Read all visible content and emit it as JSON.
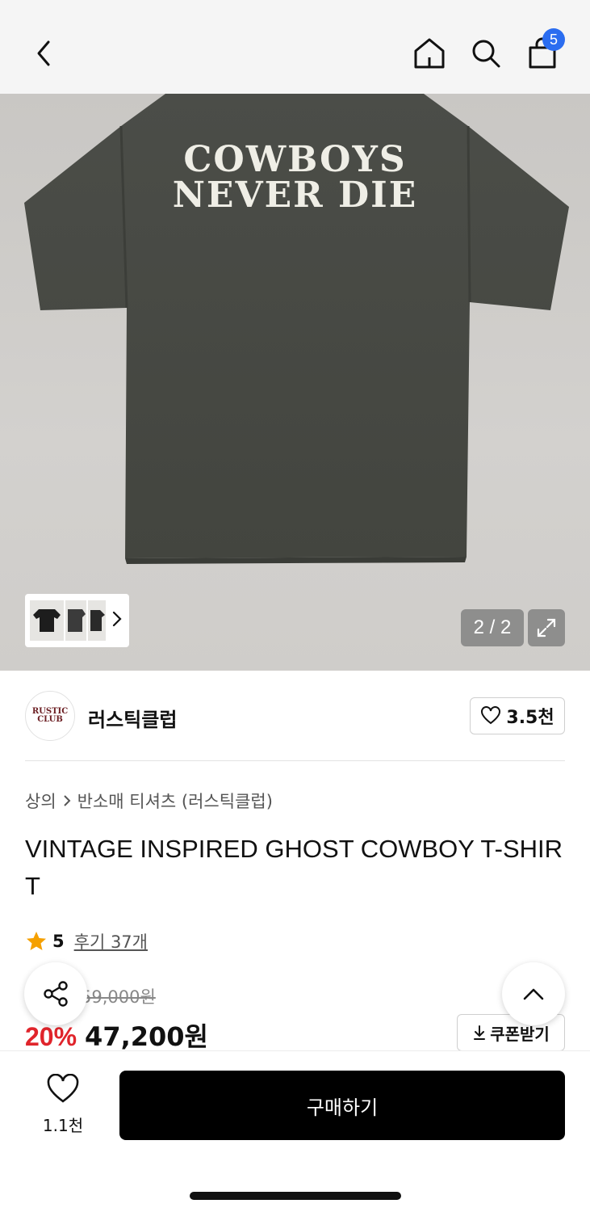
{
  "header": {
    "back_icon": "chevron-left-icon",
    "home_icon": "home-icon",
    "search_icon": "search-icon",
    "cart_icon": "shopping-bag-icon",
    "cart_count": "5",
    "badge_color": "#2b6df0"
  },
  "gallery": {
    "print_line1": "COWBOYS",
    "print_line2": "NEVER DIE",
    "pager": "2 / 2",
    "expand_icon": "expand-icon",
    "thumb_next_icon": "chevron-right-icon"
  },
  "brand": {
    "logo_line1": "RUSTIC",
    "logo_line2": "CLUB",
    "name": "러스틱클럽",
    "likes": "3.5천",
    "logo_color": "#6b1d22"
  },
  "breadcrumb": {
    "items": [
      "상의",
      "반소매 티셔츠 (러스틱클럽)"
    ]
  },
  "product": {
    "title": "VINTAGE INSPIRED GHOST COWBOY T-SHIRT",
    "rating": "5",
    "reviews": "후기 37개",
    "original_price": "59,000원",
    "discount": "20%",
    "price": "47,200원",
    "discount_color": "#e0242b"
  },
  "coupon": {
    "label": "쿠폰받기"
  },
  "bottom": {
    "wish_count": "1.1천",
    "buy_label": "구매하기"
  }
}
